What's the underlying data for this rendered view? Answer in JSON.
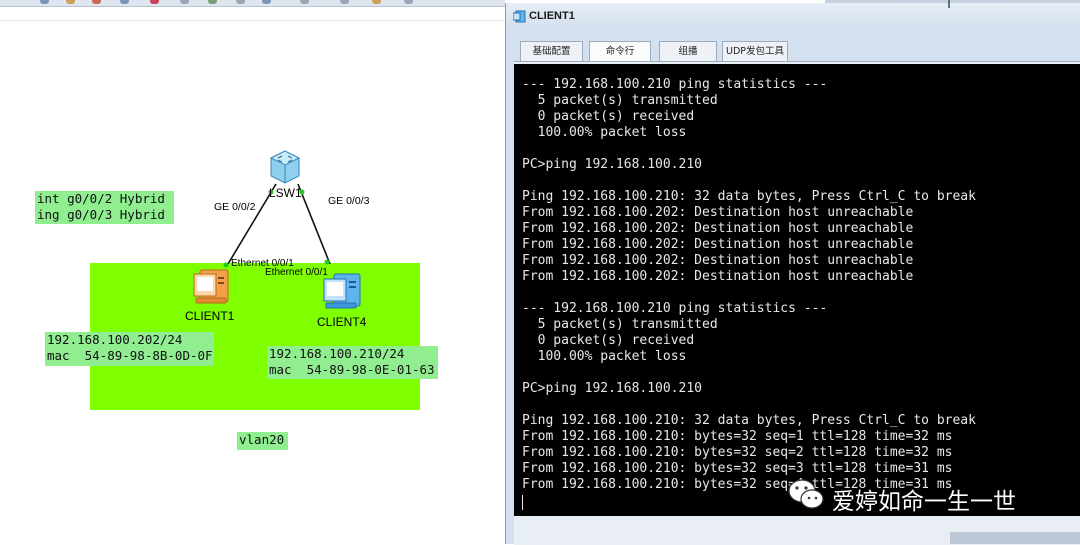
{
  "topology": {
    "notes": {
      "port_config": "int g0/0/2 Hybrid\ning g0/0/3 Hybrid",
      "client1_info": "192.168.100.202/24\nmac  54-89-98-8B-0D-0F",
      "client4_info": "192.168.100.210/24\nmac  54-89-98-0E-01-63",
      "vlan_label": "vlan20"
    },
    "switch_label": "LSW1",
    "ports": {
      "left_switch_port": "GE 0/0/2",
      "right_switch_port": "GE 0/0/3",
      "client1_port": "Ethernet 0/0/1",
      "client4_port": "Ethernet 0/0/1"
    },
    "devices": {
      "client1": "CLIENT1",
      "client4": "CLIENT4"
    },
    "colors": {
      "vlan_area": "#80ff00",
      "note_background": "#90ee90"
    }
  },
  "window": {
    "title": "CLIENT1",
    "tabs": [
      {
        "label": "基础配置"
      },
      {
        "label": "命令行"
      },
      {
        "label": "组播"
      },
      {
        "label": "UDP发包工具"
      }
    ],
    "active_tab": "命令行"
  },
  "terminal": {
    "lines": [
      "--- 192.168.100.210 ping statistics ---",
      "  5 packet(s) transmitted",
      "  0 packet(s) received",
      "  100.00% packet loss",
      "",
      "PC>ping 192.168.100.210",
      "",
      "Ping 192.168.100.210: 32 data bytes, Press Ctrl_C to break",
      "From 192.168.100.202: Destination host unreachable",
      "From 192.168.100.202: Destination host unreachable",
      "From 192.168.100.202: Destination host unreachable",
      "From 192.168.100.202: Destination host unreachable",
      "From 192.168.100.202: Destination host unreachable",
      "",
      "--- 192.168.100.210 ping statistics ---",
      "  5 packet(s) transmitted",
      "  0 packet(s) received",
      "  100.00% packet loss",
      "",
      "PC>ping 192.168.100.210",
      "",
      "Ping 192.168.100.210: 32 data bytes, Press Ctrl_C to break",
      "From 192.168.100.210: bytes=32 seq=1 ttl=128 time=32 ms",
      "From 192.168.100.210: bytes=32 seq=2 ttl=128 time=32 ms",
      "From 192.168.100.210: bytes=32 seq=3 ttl=128 time=31 ms",
      "From 192.168.100.210: bytes=32 seq=4 ttl=128 time=31 ms"
    ]
  },
  "watermark": {
    "icon": "wechat-icon",
    "text": "爱婷如命一生一世"
  }
}
